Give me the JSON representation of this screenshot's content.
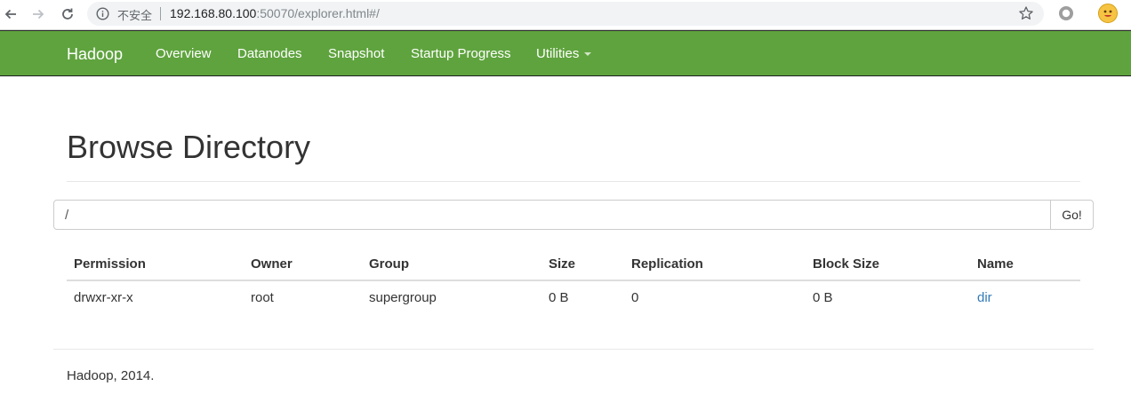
{
  "browser": {
    "security_label": "不安全",
    "url_host": "192.168.80.100",
    "url_rest": ":50070/explorer.html#/",
    "icons": [
      "back-arrow-icon",
      "forward-arrow-icon",
      "reload-icon",
      "info-icon",
      "star-icon",
      "extension-icon",
      "profile-avatar-icon"
    ]
  },
  "navbar": {
    "brand": "Hadoop",
    "items": [
      {
        "label": "Overview"
      },
      {
        "label": "Datanodes"
      },
      {
        "label": "Snapshot"
      },
      {
        "label": "Startup Progress"
      },
      {
        "label": "Utilities"
      }
    ],
    "background_color": "#5fa33e"
  },
  "page": {
    "title": "Browse Directory"
  },
  "path_bar": {
    "value": "/",
    "go_label": "Go!"
  },
  "table": {
    "columns": [
      "Permission",
      "Owner",
      "Group",
      "Size",
      "Replication",
      "Block Size",
      "Name"
    ],
    "rows": [
      {
        "permission": "drwxr-xr-x",
        "owner": "root",
        "group": "supergroup",
        "size": "0 B",
        "replication": "0",
        "block_size": "0 B",
        "name": "dir"
      }
    ],
    "link_color": "#337ab7"
  },
  "footer": {
    "text": "Hadoop, 2014."
  }
}
